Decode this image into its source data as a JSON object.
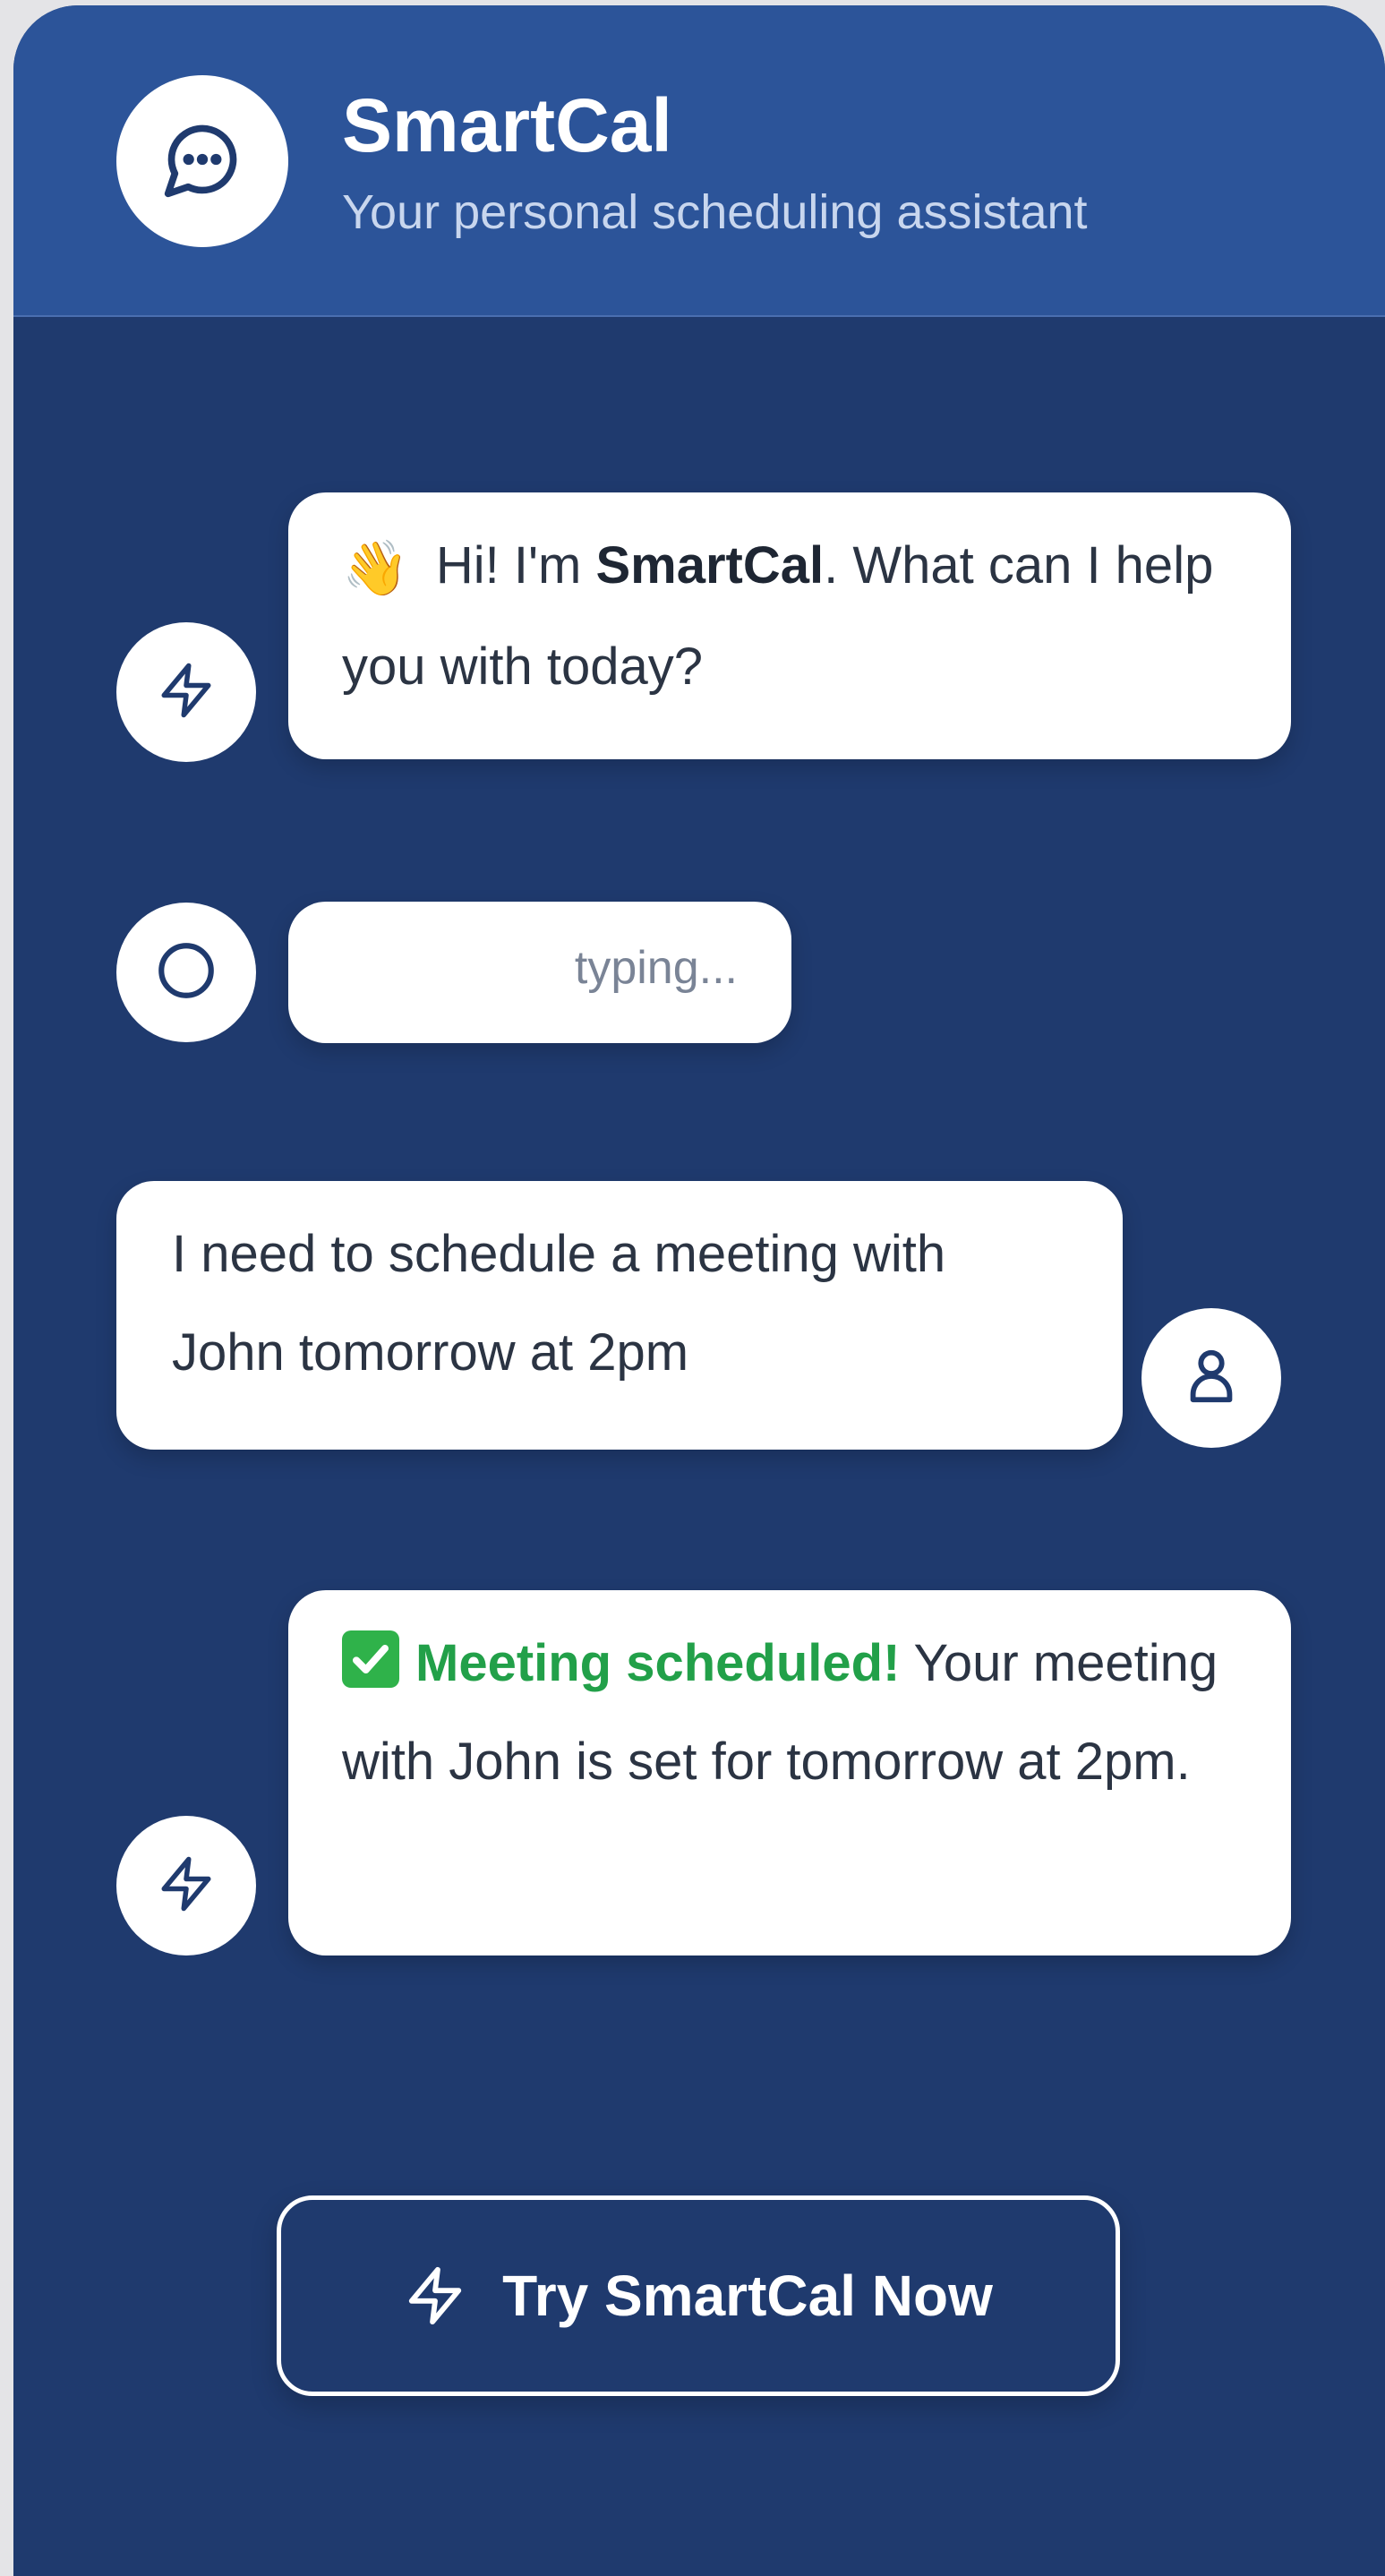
{
  "header": {
    "title": "SmartCal",
    "subtitle": "Your personal scheduling assistant",
    "logo_icon": "chat-bubble-icon"
  },
  "messages": [
    {
      "sender": "bot",
      "avatar_icon": "lightning-icon",
      "emoji": "👋",
      "text_before": " Hi! I'm ",
      "strong": "SmartCal",
      "text_after": ". What can I help you with today?"
    },
    {
      "sender": "bot",
      "avatar_icon": "circle-icon",
      "typing_label": "typing..."
    },
    {
      "sender": "user",
      "avatar_icon": "user-icon",
      "text": "I need to schedule a meeting with John tomorrow at 2pm"
    },
    {
      "sender": "bot",
      "avatar_icon": "lightning-icon",
      "emoji": "check-mark-icon",
      "success": "Meeting scheduled!",
      "text_after": " Your meeting with John is set for tomorrow at 2pm."
    }
  ],
  "cta": {
    "label": "Try SmartCal Now",
    "icon": "lightning-icon"
  },
  "colors": {
    "header_bg": "#2c5499",
    "body_bg": "#1f3a6e",
    "bubble_bg": "#ffffff",
    "success_green": "#22a049",
    "text_dark": "#2b3443"
  }
}
